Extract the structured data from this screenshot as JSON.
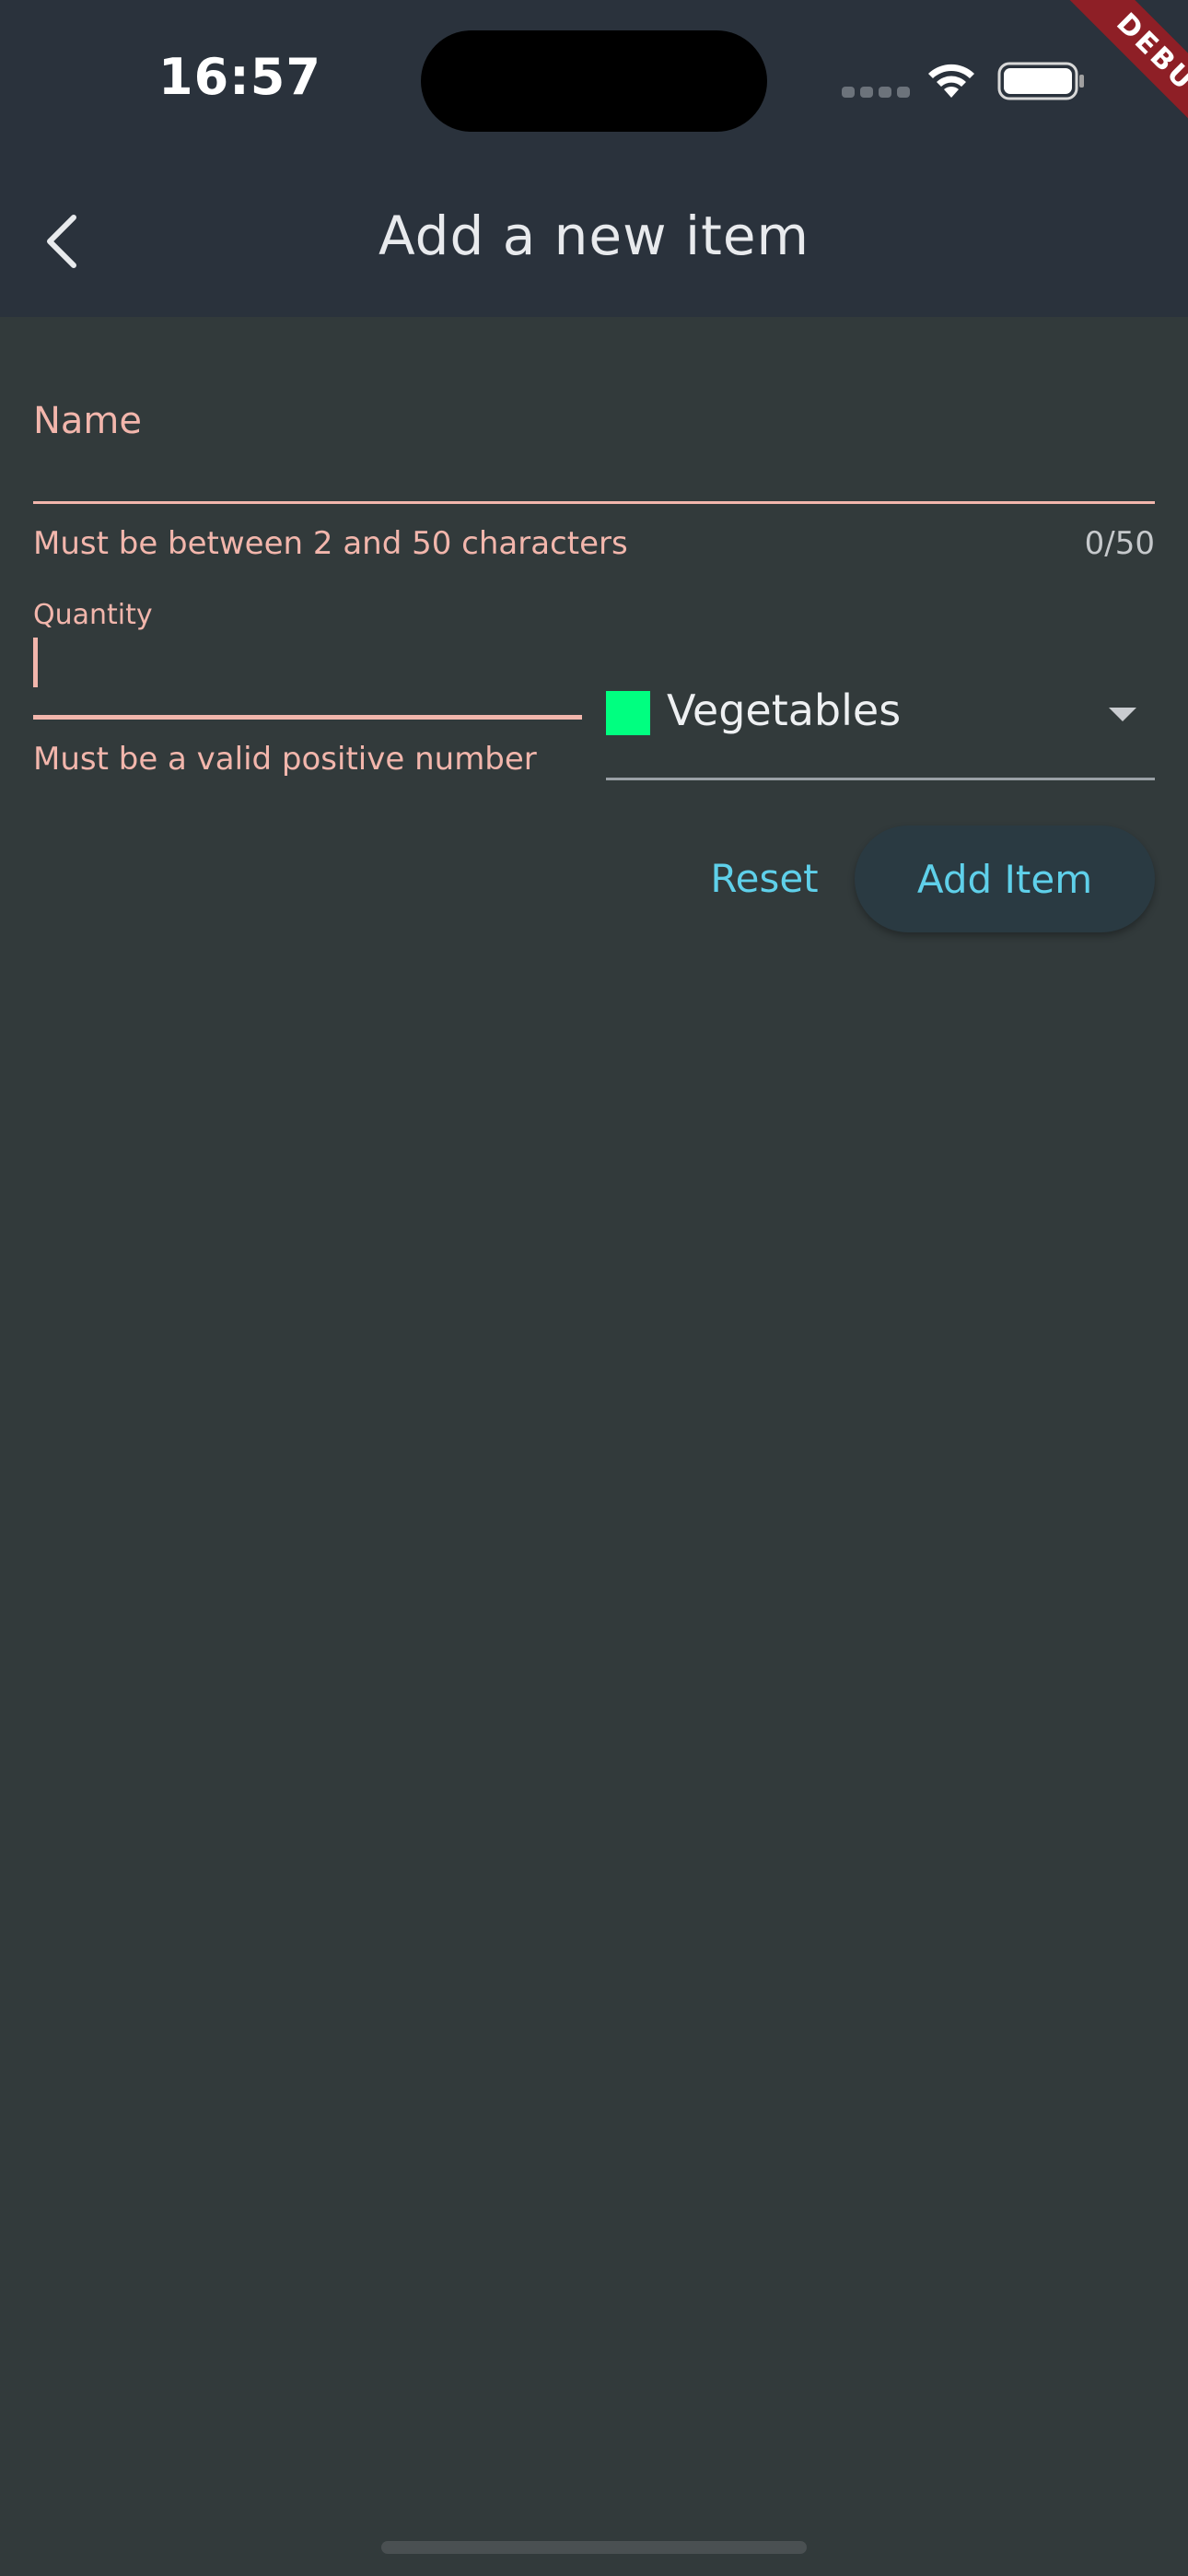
{
  "status_bar": {
    "time": "16:57"
  },
  "debug_banner": {
    "label": "DEBUG"
  },
  "app_bar": {
    "title": "Add a new item"
  },
  "form": {
    "name": {
      "label": "Name",
      "value": "",
      "error": "Must be between 2 and 50 characters",
      "counter": "0/50"
    },
    "quantity": {
      "label": "Quantity",
      "value": "",
      "error": "Must be a valid positive number"
    },
    "category": {
      "selected": "Vegetables",
      "swatch_color": "#00ff80"
    },
    "buttons": {
      "reset_label": "Reset",
      "add_label": "Add Item"
    }
  },
  "colors": {
    "error": "#f2b6ac",
    "accent": "#5fd0ea",
    "background": "#323a3b",
    "app_bar": "#2a323c"
  }
}
